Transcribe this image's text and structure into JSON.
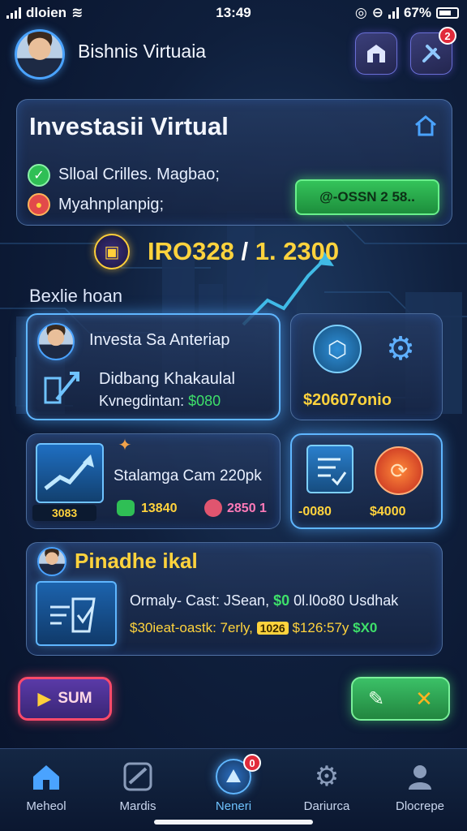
{
  "status_bar": {
    "carrier": "dloien",
    "time": "13:49",
    "battery": "67%"
  },
  "header": {
    "title": "Bishnis Virtuaia",
    "badge_count": "2"
  },
  "investment_card": {
    "title": "Investasii Virtual",
    "line1": "Slloal Crilles. Magbao;",
    "line2": "Myahnplanpig;",
    "pill": "@-OSSN 2 58.."
  },
  "balance": {
    "left": "IRO328",
    "separator": "/",
    "right": "1. 2300"
  },
  "section_label": "Bexlie hoan",
  "card_invest": {
    "title": "Investa Sa Anteriap",
    "line1": "Didbang Khakaulal",
    "line2_label": "Kvnegdintan:",
    "line2_value": "$080"
  },
  "card_assets": {
    "value": "$20607onio"
  },
  "card_chart": {
    "mini_label": "3083",
    "title": "Stalamga Cam 220pk",
    "val_a": "13840",
    "val_b": "2850 1"
  },
  "card_docs": {
    "left": "-0080",
    "right": "$4000"
  },
  "card_business": {
    "title": "Pinadhe ikal",
    "row1_label": "Ormaly- Cast:",
    "row1_mid": "JSean,",
    "row1_green": "$0",
    "row1_right": "0l.l0o80 Usdhak",
    "row2_label": "$30ieat-oastk: 7erly,",
    "row2_chip": "1026",
    "row2_mid": "$126:57y",
    "row2_green": "$X0"
  },
  "actions": {
    "start_label": "SUM"
  },
  "nav": {
    "items": [
      {
        "label": "Meheol"
      },
      {
        "label": "Mardis"
      },
      {
        "label": "Neneri",
        "badge": "0"
      },
      {
        "label": "Dariurca"
      },
      {
        "label": "Dlocrepe"
      }
    ]
  },
  "colors": {
    "accent_green": "#3ee06a",
    "accent_yellow": "#ffd33d",
    "accent_blue": "#4aa3ff",
    "badge_red": "#e12b3b",
    "background": "#0f1f3c"
  }
}
